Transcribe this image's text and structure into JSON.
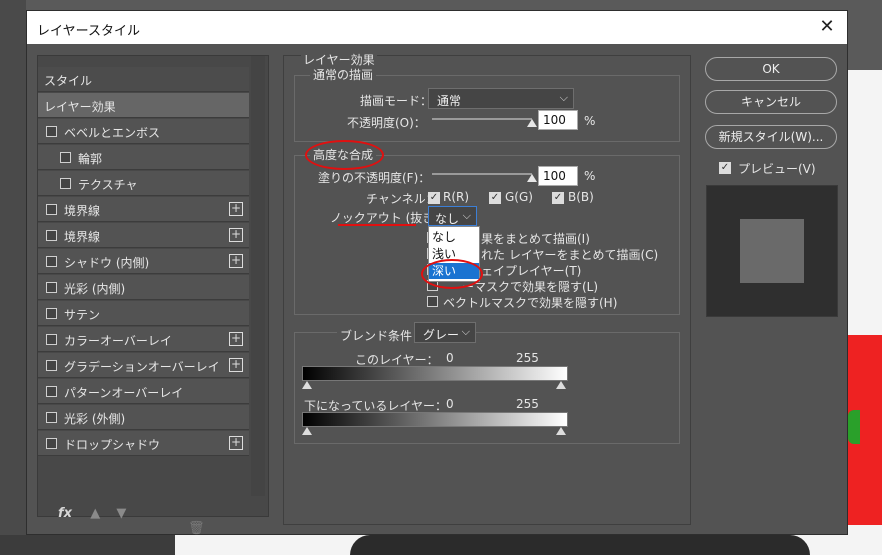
{
  "dialog": {
    "title": "レイヤースタイル",
    "close_icon": "close-icon"
  },
  "left_panel": {
    "items": [
      {
        "label": "スタイル",
        "checkbox": false,
        "plus": false,
        "indent": 0,
        "selected": false
      },
      {
        "label": "レイヤー効果",
        "checkbox": false,
        "plus": false,
        "indent": 0,
        "selected": true
      },
      {
        "label": "ベベルとエンボス",
        "checkbox": true,
        "plus": false,
        "indent": 0,
        "selected": false
      },
      {
        "label": "輪郭",
        "checkbox": true,
        "plus": false,
        "indent": 1,
        "selected": false
      },
      {
        "label": "テクスチャ",
        "checkbox": true,
        "plus": false,
        "indent": 1,
        "selected": false
      },
      {
        "label": "境界線",
        "checkbox": true,
        "plus": true,
        "indent": 0,
        "selected": false
      },
      {
        "label": "境界線",
        "checkbox": true,
        "plus": true,
        "indent": 0,
        "selected": false
      },
      {
        "label": "シャドウ (内側)",
        "checkbox": true,
        "plus": true,
        "indent": 0,
        "selected": false
      },
      {
        "label": "光彩 (内側)",
        "checkbox": true,
        "plus": false,
        "indent": 0,
        "selected": false
      },
      {
        "label": "サテン",
        "checkbox": true,
        "plus": false,
        "indent": 0,
        "selected": false
      },
      {
        "label": "カラーオーバーレイ",
        "checkbox": true,
        "plus": true,
        "indent": 0,
        "selected": false
      },
      {
        "label": "グラデーションオーバーレイ",
        "checkbox": true,
        "plus": true,
        "indent": 0,
        "selected": false
      },
      {
        "label": "パターンオーバーレイ",
        "checkbox": true,
        "plus": false,
        "indent": 0,
        "selected": false
      },
      {
        "label": "光彩 (外側)",
        "checkbox": true,
        "plus": false,
        "indent": 0,
        "selected": false
      },
      {
        "label": "ドロップシャドウ",
        "checkbox": true,
        "plus": true,
        "indent": 0,
        "selected": false
      }
    ],
    "fx_label": "fx"
  },
  "layer_effects": {
    "header": "レイヤー効果",
    "normal_blend": {
      "legend": "通常の描画",
      "blend_mode_label": "描画モード：",
      "blend_mode_value": "通常",
      "opacity_label": "不透明度(O)：",
      "opacity_value": "100",
      "opacity_fraction": 1.0,
      "percent": "%"
    },
    "advanced_blend": {
      "legend": "高度な合成",
      "fill_opacity_label": "塗りの不透明度(F)：",
      "fill_opacity_value": "100",
      "fill_opacity_fraction": 1.0,
      "percent": "%",
      "channels_label": "チャンネル：",
      "channel_r": "R(R)",
      "channel_g": "G(G)",
      "channel_b": "B(B)",
      "knockout_label": "ノックアウト (抜き)：",
      "knockout_value": "なし",
      "knockout_options": [
        "なし",
        "浅い",
        "深い"
      ],
      "knockout_highlighted": "深い",
      "opt1": "果をまとめて描画(I)",
      "opt2": "れた レイヤーをまとめて描画(C)",
      "opt3": "ェイプレイヤー(T)",
      "opt4": "ーマスクで効果を隠す(L)",
      "opt5": "ベクトルマスクで効果を隠す(H)"
    },
    "blend_if": {
      "label": "ブレンド条件：",
      "value": "グレー",
      "this_layer_label": "このレイヤー：",
      "this_layer_min": "0",
      "this_layer_max": "255",
      "underlying_label": "下になっているレイヤー：",
      "underlying_min": "0",
      "underlying_max": "255"
    }
  },
  "buttons": {
    "ok": "OK",
    "cancel": "キャンセル",
    "new_style": "新規スタイル(W)...",
    "preview_label": "プレビュー(V)"
  },
  "colors": {
    "annotation_red": "#e01010",
    "selection_blue": "#1a73d1",
    "dialog_bg": "#535353"
  }
}
